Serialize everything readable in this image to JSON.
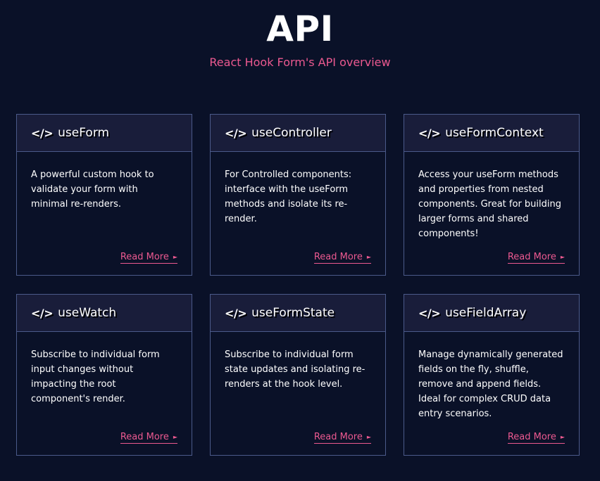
{
  "header": {
    "title": "API",
    "subtitle": "React Hook Form's API overview"
  },
  "cards": [
    {
      "icon": "</>",
      "title": "useForm",
      "description": "A powerful custom hook to validate your form with minimal re-renders.",
      "link_label": "Read More",
      "link_arrow": "►"
    },
    {
      "icon": "</>",
      "title": "useController",
      "description": "For Controlled components: interface with the useForm methods and isolate its re-render.",
      "link_label": "Read More",
      "link_arrow": "►"
    },
    {
      "icon": "</>",
      "title": "useFormContext",
      "description": "Access your useForm methods and properties from nested components. Great for building larger forms and shared components!",
      "link_label": "Read More",
      "link_arrow": "►"
    },
    {
      "icon": "</>",
      "title": "useWatch",
      "description": "Subscribe to individual form input changes without impacting the root component's render.",
      "link_label": "Read More",
      "link_arrow": "►"
    },
    {
      "icon": "</>",
      "title": "useFormState",
      "description": "Subscribe to individual form state updates and isolating re-renders at the hook level.",
      "link_label": "Read More",
      "link_arrow": "►"
    },
    {
      "icon": "</>",
      "title": "useFieldArray",
      "description": "Manage dynamically generated fields on the fly, shuffle, remove and append fields. Ideal for complex CRUD data entry scenarios.",
      "link_label": "Read More",
      "link_arrow": "►"
    }
  ],
  "colors": {
    "background": "#0a1128",
    "card_header": "#191d3a",
    "border": "#4b5a8a",
    "accent": "#ec5990",
    "text": "#ffffff"
  }
}
